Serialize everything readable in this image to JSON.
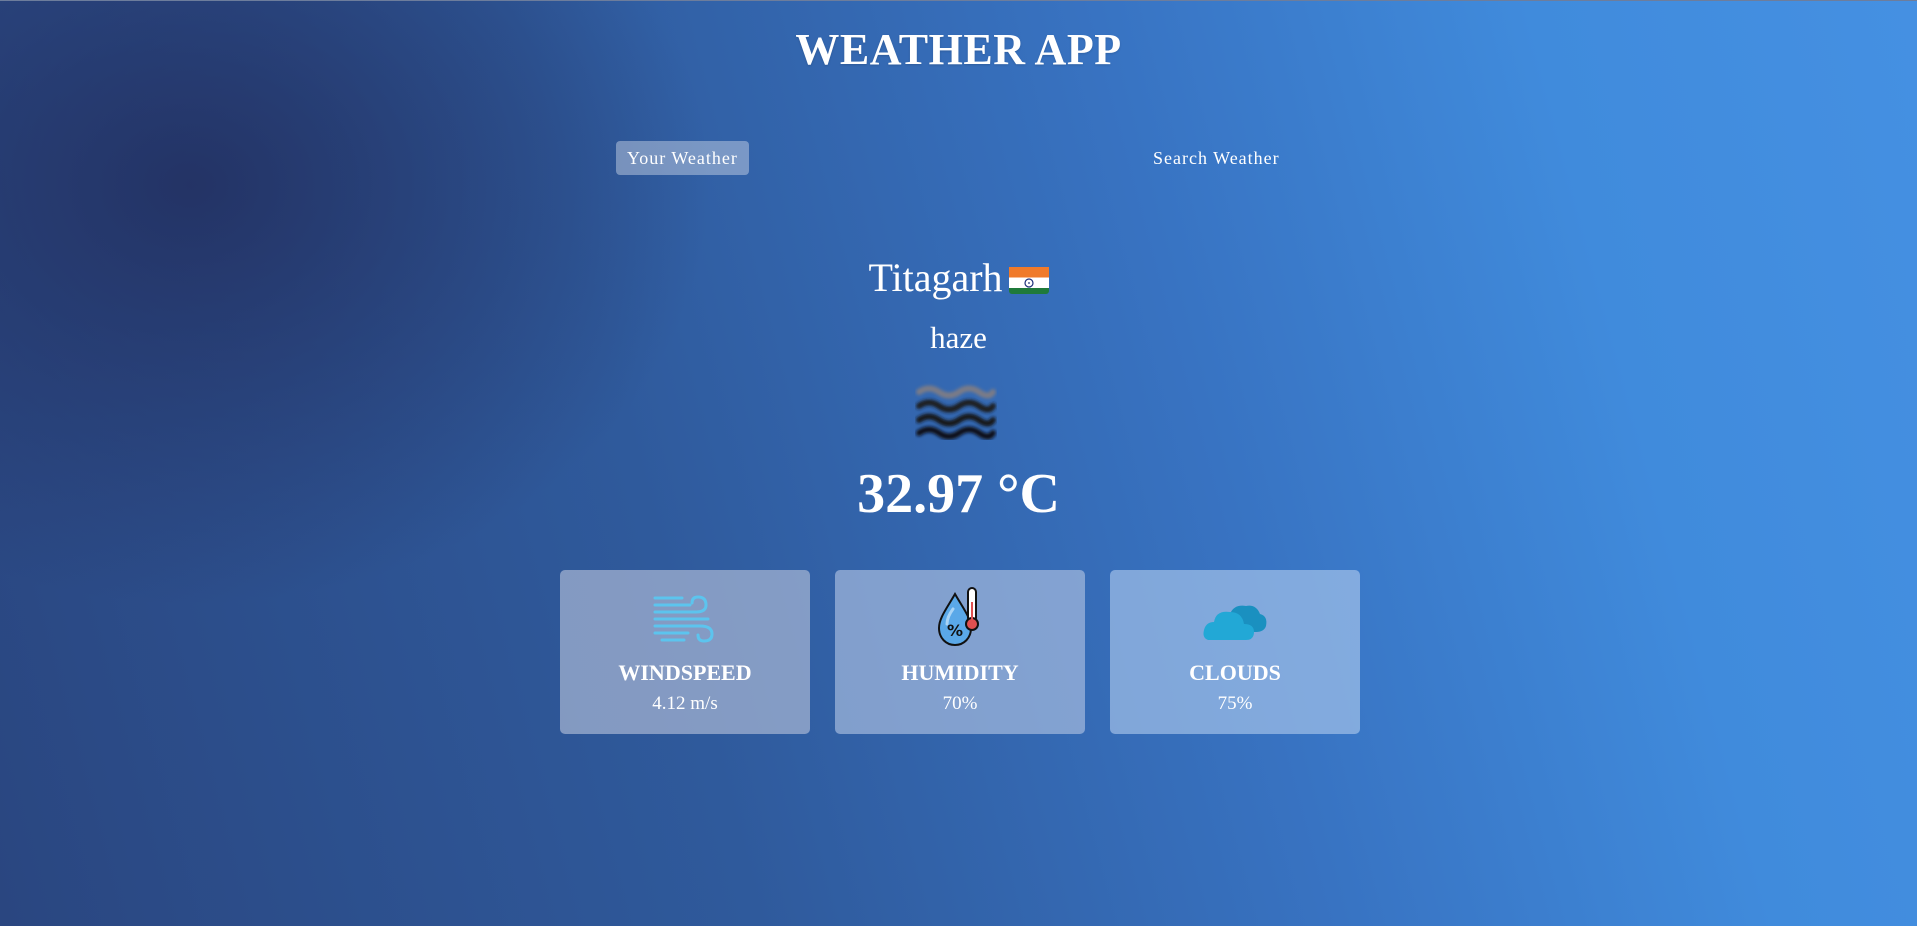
{
  "app": {
    "title": "WEATHER APP"
  },
  "tabs": [
    {
      "label": "Your Weather",
      "active": true
    },
    {
      "label": "Search Weather",
      "active": false
    }
  ],
  "weather": {
    "city": "Titagarh",
    "country_flag": "india-flag-icon",
    "description": "haze",
    "condition_icon": "haze-icon",
    "temperature": "32.97 °C"
  },
  "cards": [
    {
      "icon": "wind-icon",
      "label": "WINDSPEED",
      "value": "4.12 m/s"
    },
    {
      "icon": "humidity-drop-icon",
      "label": "HUMIDITY",
      "value": "70%"
    },
    {
      "icon": "cloud-icon",
      "label": "CLOUDS",
      "value": "75%"
    }
  ],
  "colors": {
    "background_dark": "#222e5e",
    "background_mid": "#2f5a9c",
    "background_light": "#4590e2",
    "text": "#ffffff",
    "active_tab": "#d2dceb",
    "wind_icon": "#5cc4ee",
    "cloud_icon": "#1fa3cf"
  }
}
